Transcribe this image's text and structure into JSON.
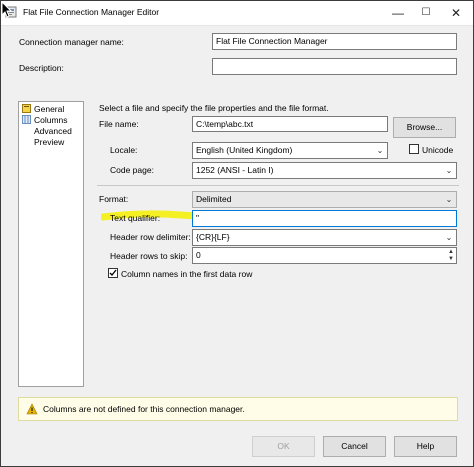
{
  "window": {
    "title": "Flat File Connection Manager Editor",
    "minimize_glyph": "—",
    "maximize_glyph": "☐",
    "close_glyph": "✕"
  },
  "connection": {
    "name_label": "Connection manager name:",
    "name_value": "Flat File Connection Manager",
    "description_label": "Description:",
    "description_value": ""
  },
  "nav": {
    "items": [
      {
        "label": "General",
        "selected": true
      },
      {
        "label": "Columns"
      },
      {
        "label": "Advanced"
      },
      {
        "label": "Preview"
      }
    ]
  },
  "general": {
    "intro": "Select a file and specify the file properties and the file format.",
    "file_name_label": "File name:",
    "file_name_value": "C:\\temp\\abc.txt",
    "browse_label": "Browse...",
    "locale_label": "Locale:",
    "locale_value": "English (United Kingdom)",
    "unicode_label": "Unicode",
    "unicode_checked": false,
    "code_page_label": "Code page:",
    "code_page_value": "1252  (ANSI - Latin I)",
    "format_label": "Format:",
    "format_value": "Delimited",
    "text_qualifier_label": "Text qualifier:",
    "text_qualifier_value": "\"",
    "header_row_delimiter_label": "Header row delimiter:",
    "header_row_delimiter_value": "{CR}{LF}",
    "header_rows_to_skip_label": "Header rows to skip:",
    "header_rows_to_skip_value": "0",
    "column_names_label": "Column names in the first data row",
    "column_names_checked": true
  },
  "warning": {
    "text": "Columns are not defined for this connection manager."
  },
  "footer": {
    "ok_label": "OK",
    "cancel_label": "Cancel",
    "help_label": "Help"
  },
  "colors": {
    "highlight": "#f5f000",
    "warning_bg": "#fffde7",
    "warning_icon": "#e8b400"
  }
}
